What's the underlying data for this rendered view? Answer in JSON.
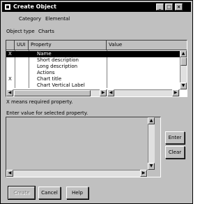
{
  "window": {
    "title": "Create Object"
  },
  "category": {
    "label": "Category",
    "value": "Elemental"
  },
  "object_type": {
    "label": "Object type",
    "value": "Charts"
  },
  "grid": {
    "columns": [
      "UUI",
      "Property",
      "Value"
    ],
    "rows": [
      {
        "req": "X",
        "uui": "",
        "property": "Name",
        "value": ""
      },
      {
        "req": "",
        "uui": "",
        "property": "Short description",
        "value": ""
      },
      {
        "req": "",
        "uui": "",
        "property": "Long description",
        "value": ""
      },
      {
        "req": "",
        "uui": "",
        "property": "Actions",
        "value": ""
      },
      {
        "req": "X",
        "uui": "",
        "property": "Chart title",
        "value": ""
      },
      {
        "req": "",
        "uui": "",
        "property": "Chart Vertical Label",
        "value": ""
      }
    ]
  },
  "required_note": "X means required property.",
  "entry": {
    "label": "Enter value for selected property.",
    "value": ""
  },
  "buttons": {
    "enter": "Enter",
    "clear": "Clear",
    "create": "Create",
    "cancel": "Cancel",
    "help": "Help"
  }
}
